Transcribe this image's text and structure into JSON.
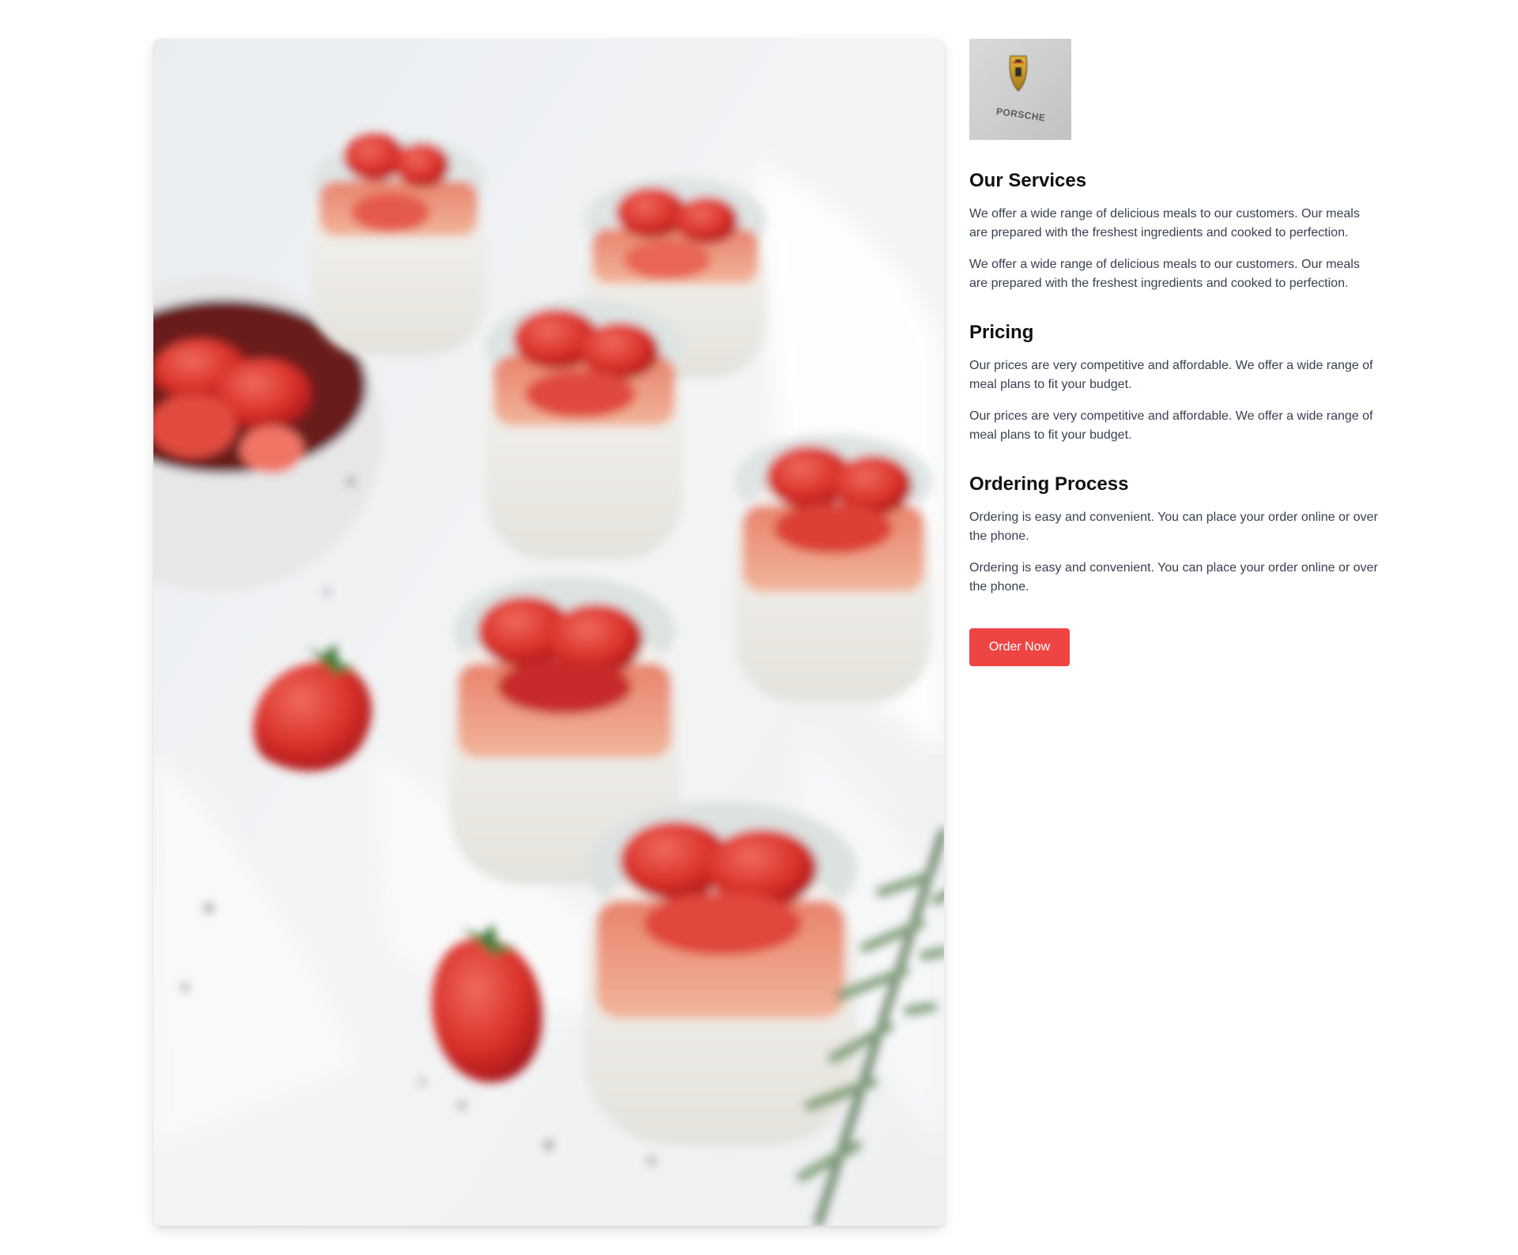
{
  "hero_image": {
    "icon": "strawberry-panna-cotta-photo"
  },
  "logo": {
    "icon": "porsche-crest-logo",
    "text": "PORSCHE"
  },
  "sections": [
    {
      "title": "Our Services",
      "paragraphs": [
        "We offer a wide range of delicious meals to our customers. Our meals are prepared with the freshest ingredients and cooked to perfection.",
        "We offer a wide range of delicious meals to our customers. Our meals are prepared with the freshest ingredients and cooked to perfection."
      ]
    },
    {
      "title": "Pricing",
      "paragraphs": [
        "Our prices are very competitive and affordable. We offer a wide range of meal plans to fit your budget.",
        "Our prices are very competitive and affordable. We offer a wide range of meal plans to fit your budget."
      ]
    },
    {
      "title": "Ordering Process",
      "paragraphs": [
        "Ordering is easy and convenient. You can place your order online or over the phone.",
        "Ordering is easy and convenient. You can place your order online or over the phone."
      ]
    }
  ],
  "cta": {
    "label": "Order Now"
  },
  "colors": {
    "accent": "#ef4444",
    "heading": "#111111",
    "body_text": "#374151",
    "background": "#ffffff"
  }
}
